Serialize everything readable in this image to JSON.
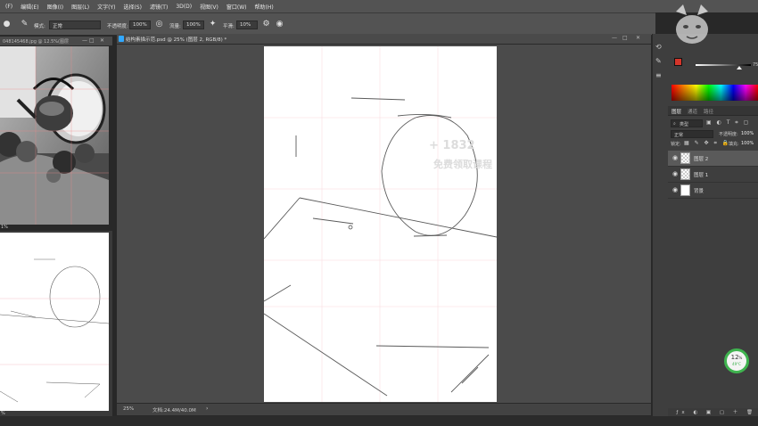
{
  "menu": [
    "(F)",
    "编辑(E)",
    "图像(I)",
    "图层(L)",
    "文字(Y)",
    "选择(S)",
    "滤镜(T)",
    "3D(D)",
    "视图(V)",
    "窗口(W)",
    "帮助(H)"
  ],
  "options": {
    "mode_label": "模式:",
    "mode_value": "正常",
    "opacity_label": "不透明度:",
    "opacity_value": "100%",
    "flow_label": "流量:",
    "flow_value": "100%",
    "smooth_label": "平滑:",
    "smooth_value": "10%"
  },
  "ref_window": {
    "tab": "048145468.jpg @ 12.5%(图层",
    "status": "1%",
    "status2": "%"
  },
  "document": {
    "tab": "结构素描示范.psd @ 25% (图层 2, RGB/8) *",
    "zoom": "25%",
    "docinfo": "文档:24.4M/40.0M"
  },
  "watermark": {
    "line1": "+ 1832",
    "line2": "免费领取课程"
  },
  "layers_panel": {
    "tabs": [
      "图层",
      "通道",
      "路径"
    ],
    "filter_kind": "类型",
    "blend_mode": "正常",
    "opacity_label": "不透明度:",
    "opacity_value": "100%",
    "lock_label": "锁定:",
    "fill_label": "填充:",
    "fill_value": "100%",
    "layers": [
      {
        "name": "图层 2",
        "selected": true
      },
      {
        "name": "图层 1",
        "selected": false
      },
      {
        "name": "背景",
        "selected": false
      }
    ]
  },
  "color_panel": {
    "value": "75"
  },
  "perf_widget": {
    "percent": "12",
    "temp": "49°C"
  },
  "colors": {
    "ui_dark": "#282828",
    "ui_panel": "#3e3e3e",
    "ui_bar": "#535353",
    "foreground": "#d3352a",
    "grid_pink": "#f4b6c0",
    "perf_green": "#3fb34f"
  }
}
